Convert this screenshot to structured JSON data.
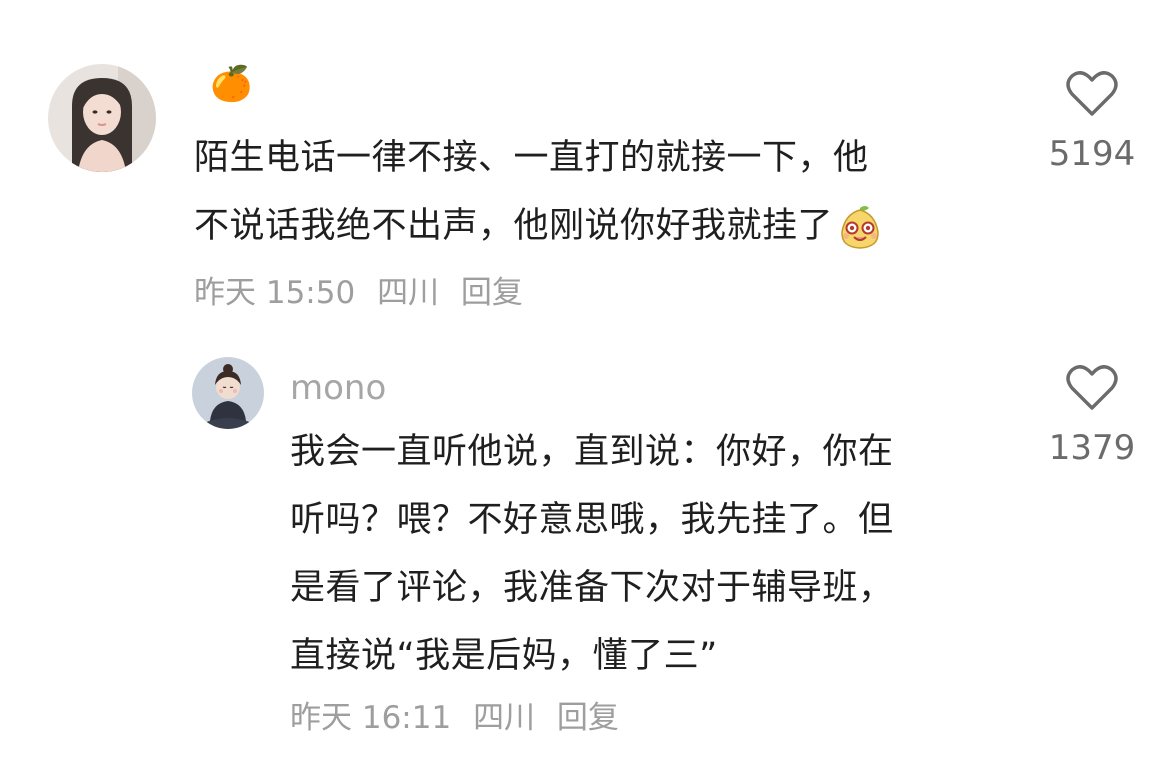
{
  "comments": [
    {
      "username": "🍊",
      "text_lines": [
        "陌生电话一律不接、一直打的就接一下，他",
        "不说话我绝不出声，他刚说你好我就挂了"
      ],
      "inline_emoji": "smiling-pear-emoji",
      "time": "昨天 15:50",
      "location": "四川",
      "reply_label": "回复",
      "likes": "5194"
    },
    {
      "username": "mono",
      "text_lines": [
        "我会一直听他说，直到说：你好，你在",
        "听吗？喂？不好意思哦，我先挂了。但",
        "是看了评论，我准备下次对于辅导班，",
        "直接说“我是后妈，懂了三”"
      ],
      "time": "昨天 16:11",
      "location": "四川",
      "reply_label": "回复",
      "likes": "1379"
    }
  ],
  "icons": {
    "like": "heart-outline-icon"
  },
  "colors": {
    "text": "#1f1f1f",
    "meta": "#9e9e9e",
    "username": "#a6a6a6",
    "count": "#6b6b6b"
  }
}
